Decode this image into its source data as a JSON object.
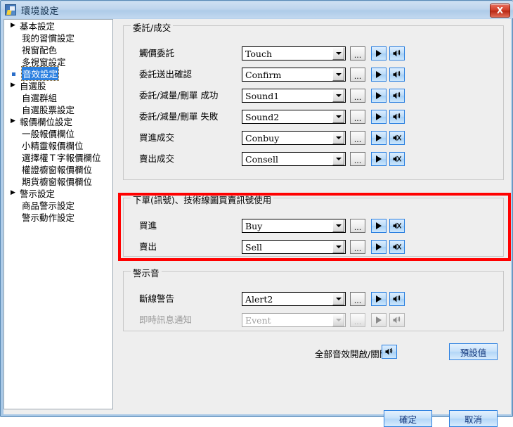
{
  "window": {
    "title": "環境設定",
    "close_label": "X",
    "app_icon": "app-icon"
  },
  "sidebar": {
    "items": [
      {
        "label": "基本設定",
        "level": "root",
        "arrow": "▶",
        "selected": false
      },
      {
        "label": "我的習慣設定",
        "level": "child",
        "arrow": "",
        "selected": false
      },
      {
        "label": "視窗配色",
        "level": "child",
        "arrow": "",
        "selected": false
      },
      {
        "label": "多視窗設定",
        "level": "child",
        "arrow": "",
        "selected": false
      },
      {
        "label": "音效設定",
        "level": "child",
        "arrow": "",
        "selected": true
      },
      {
        "label": "自選股",
        "level": "root",
        "arrow": "▶",
        "selected": false
      },
      {
        "label": "自選群組",
        "level": "child",
        "arrow": "",
        "selected": false
      },
      {
        "label": "自選股票設定",
        "level": "child",
        "arrow": "",
        "selected": false
      },
      {
        "label": "報價欄位設定",
        "level": "root",
        "arrow": "▶",
        "selected": false
      },
      {
        "label": "一般報價欄位",
        "level": "child",
        "arrow": "",
        "selected": false
      },
      {
        "label": "小精靈報價欄位",
        "level": "child",
        "arrow": "",
        "selected": false
      },
      {
        "label": "選擇權Ｔ字報價欄位",
        "level": "child",
        "arrow": "",
        "selected": false
      },
      {
        "label": "權證櫥窗報價欄位",
        "level": "child",
        "arrow": "",
        "selected": false
      },
      {
        "label": "期貨櫥窗報價欄位",
        "level": "child",
        "arrow": "",
        "selected": false
      },
      {
        "label": "警示設定",
        "level": "root",
        "arrow": "▶",
        "selected": false
      },
      {
        "label": "商品警示設定",
        "level": "child",
        "arrow": "",
        "selected": false
      },
      {
        "label": "警示動作設定",
        "level": "child",
        "arrow": "",
        "selected": false
      }
    ]
  },
  "groups": [
    {
      "title": "委託/成交",
      "rows": [
        {
          "label": "觸價委託",
          "value": "Touch",
          "dots": "...",
          "play_icon": "play-icon",
          "sound_icon": "speaker-on-icon",
          "enabled": true
        },
        {
          "label": "委託送出確認",
          "value": "Confirm",
          "dots": "...",
          "play_icon": "play-icon",
          "sound_icon": "speaker-on-icon",
          "enabled": true
        },
        {
          "label": "委託/減量/刪單 成功",
          "value": "Sound1",
          "dots": "...",
          "play_icon": "play-icon",
          "sound_icon": "speaker-on-icon",
          "enabled": true
        },
        {
          "label": "委託/減量/刪單 失敗",
          "value": "Sound2",
          "dots": "...",
          "play_icon": "play-icon",
          "sound_icon": "speaker-on-icon",
          "enabled": true
        },
        {
          "label": "買進成交",
          "value": "Conbuy",
          "dots": "...",
          "play_icon": "play-icon",
          "sound_icon": "speaker-muted-icon",
          "enabled": true
        },
        {
          "label": "賣出成交",
          "value": "Consell",
          "dots": "...",
          "play_icon": "play-icon",
          "sound_icon": "speaker-muted-icon",
          "enabled": true
        }
      ]
    },
    {
      "title": "下單(訊號)、技術線圖買賣訊號使用",
      "highlighted": true,
      "rows": [
        {
          "label": "買進",
          "value": "Buy",
          "dots": "...",
          "play_icon": "play-icon",
          "sound_icon": "speaker-muted-icon",
          "enabled": true
        },
        {
          "label": "賣出",
          "value": "Sell",
          "dots": "...",
          "play_icon": "play-icon",
          "sound_icon": "speaker-muted-icon",
          "enabled": true
        }
      ]
    },
    {
      "title": "警示音",
      "rows": [
        {
          "label": "斷線警告",
          "value": "Alert2",
          "dots": "...",
          "play_icon": "play-icon",
          "sound_icon": "speaker-on-icon",
          "enabled": true
        },
        {
          "label": "即時訊息通知",
          "value": "Event",
          "dots": "...",
          "play_icon": "play-icon",
          "sound_icon": "speaker-on-icon",
          "enabled": false
        }
      ]
    }
  ],
  "footer": {
    "all_toggle_label": "全部音效開啟/關閉",
    "all_toggle_icon": "speaker-on-icon",
    "default_button": "預設值",
    "ok_button": "確定",
    "cancel_button": "取消"
  },
  "colors": {
    "accent": "#2a7fe0",
    "highlight_rect": "#ff0000",
    "panel_bg": "#eeeeee",
    "title_text": "#17334f"
  }
}
